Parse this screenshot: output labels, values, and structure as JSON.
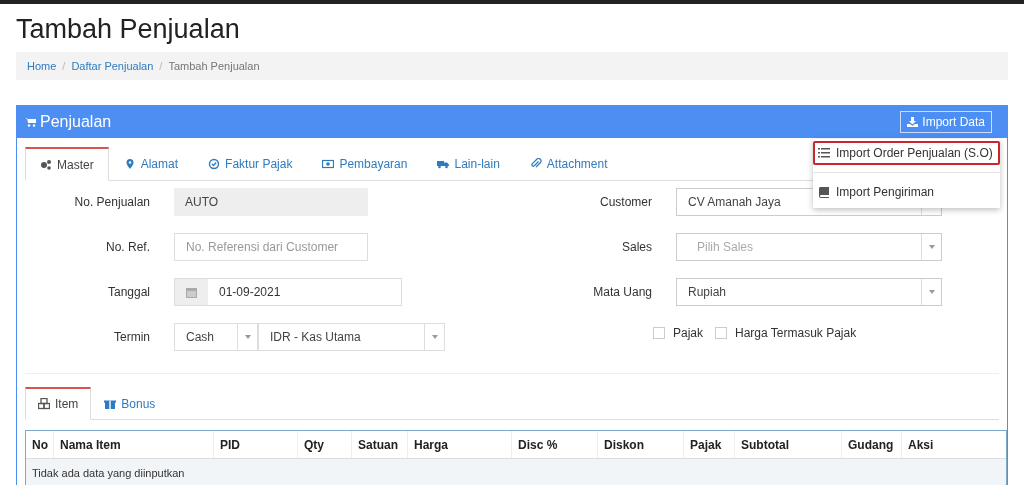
{
  "page_title": "Tambah Penjualan",
  "breadcrumb": [
    "Home",
    "Daftar Penjualan",
    "Tambah Penjualan"
  ],
  "breadcrumb_separator": "/",
  "panel": {
    "title": "Penjualan",
    "import_button": "Import Data",
    "import_menu": {
      "expanded": true,
      "items": [
        {
          "label": "Import Order Penjualan (S.O)",
          "selected": true
        },
        {
          "label": "Import Pengiriman",
          "selected": false
        }
      ]
    }
  },
  "tabs": [
    {
      "label": "Master",
      "selected": true
    },
    {
      "label": "Alamat",
      "selected": false
    },
    {
      "label": "Faktur Pajak",
      "selected": false
    },
    {
      "label": "Pembayaran",
      "selected": false
    },
    {
      "label": "Lain-lain",
      "selected": false
    },
    {
      "label": "Attachment",
      "selected": false
    }
  ],
  "form_left": [
    {
      "label": "No. Penjualan",
      "kind": "readonly",
      "value": "AUTO"
    },
    {
      "label": "No. Ref.",
      "kind": "text",
      "placeholder": "No. Referensi dari Customer"
    },
    {
      "label": "Tanggal",
      "kind": "date",
      "value": "01-09-2021"
    },
    {
      "label": "Termin",
      "kind": "double_select",
      "value": "Cash",
      "value_2": "IDR - Kas Utama"
    }
  ],
  "form_right": [
    {
      "label": "Customer",
      "kind": "select",
      "value": "CV Amanah Jaya"
    },
    {
      "label": "Sales",
      "kind": "select",
      "placeholder": "Pilih Sales"
    },
    {
      "label": "Mata Uang",
      "kind": "select",
      "value": "Rupiah"
    }
  ],
  "checkboxes": [
    {
      "label": "Pajak",
      "checked": false
    },
    {
      "label": "Harga Termasuk Pajak",
      "checked": false
    }
  ],
  "item_tabs": [
    {
      "label": "Item",
      "selected": true
    },
    {
      "label": "Bonus",
      "selected": false
    }
  ],
  "table": {
    "columns": [
      "No",
      "Nama Item",
      "PID",
      "Qty",
      "Satuan",
      "Harga",
      "Disc %",
      "Diskon",
      "Pajak",
      "Subtotal",
      "Gudang",
      "Aksi"
    ],
    "empty_message": "Tidak ada data yang diinputkan"
  }
}
